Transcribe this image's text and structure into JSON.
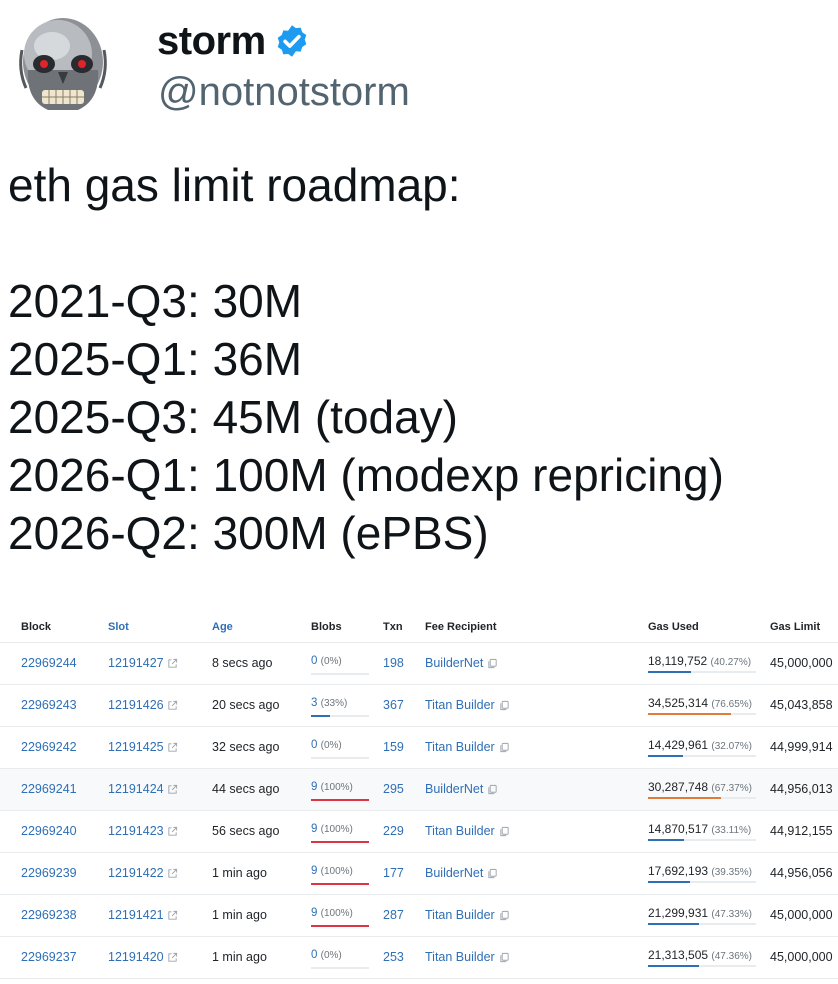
{
  "tweet": {
    "display_name": "storm",
    "handle": "@notnotstorm",
    "verified_icon": "verified-badge-icon",
    "lines": [
      "eth gas limit roadmap:",
      "",
      "2021-Q3: 30M",
      "2025-Q1: 36M",
      "2025-Q3: 45M (today)",
      "2026-Q1: 100M (modexp repricing)",
      "2026-Q2: 300M (ePBS)"
    ]
  },
  "table": {
    "headers": {
      "block": "Block",
      "slot": "Slot",
      "age": "Age",
      "blobs": "Blobs",
      "txn": "Txn",
      "fee_recipient": "Fee Recipient",
      "gas_used": "Gas Used",
      "gas_limit": "Gas Limit"
    },
    "colors": {
      "link": "#2f6fb6",
      "blob_low": "#2f6fb6",
      "blob_full": "#dc3545",
      "gas_normal": "#2f6fb6",
      "gas_high": "#e07b39"
    },
    "rows": [
      {
        "block": "22969244",
        "slot": "12191427",
        "age": "8 secs ago",
        "blobs": "0",
        "blobs_pct": "(0%)",
        "blobs_level": 0,
        "txn": "198",
        "fee_recipient": "BuilderNet",
        "gas_used": "18,119,752",
        "gas_pct": "(40.27%)",
        "gas_level": 0.4027,
        "gas_limit": "45,000,000",
        "shaded": false
      },
      {
        "block": "22969243",
        "slot": "12191426",
        "age": "20 secs ago",
        "blobs": "3",
        "blobs_pct": "(33%)",
        "blobs_level": 0.33,
        "txn": "367",
        "fee_recipient": "Titan Builder",
        "gas_used": "34,525,314",
        "gas_pct": "(76.65%)",
        "gas_level": 0.7665,
        "gas_limit": "45,043,858",
        "shaded": false
      },
      {
        "block": "22969242",
        "slot": "12191425",
        "age": "32 secs ago",
        "blobs": "0",
        "blobs_pct": "(0%)",
        "blobs_level": 0,
        "txn": "159",
        "fee_recipient": "Titan Builder",
        "gas_used": "14,429,961",
        "gas_pct": "(32.07%)",
        "gas_level": 0.3207,
        "gas_limit": "44,999,914",
        "shaded": false
      },
      {
        "block": "22969241",
        "slot": "12191424",
        "age": "44 secs ago",
        "blobs": "9",
        "blobs_pct": "(100%)",
        "blobs_level": 1,
        "txn": "295",
        "fee_recipient": "BuilderNet",
        "gas_used": "30,287,748",
        "gas_pct": "(67.37%)",
        "gas_level": 0.6737,
        "gas_limit": "44,956,013",
        "shaded": true
      },
      {
        "block": "22969240",
        "slot": "12191423",
        "age": "56 secs ago",
        "blobs": "9",
        "blobs_pct": "(100%)",
        "blobs_level": 1,
        "txn": "229",
        "fee_recipient": "Titan Builder",
        "gas_used": "14,870,517",
        "gas_pct": "(33.11%)",
        "gas_level": 0.3311,
        "gas_limit": "44,912,155",
        "shaded": false
      },
      {
        "block": "22969239",
        "slot": "12191422",
        "age": "1 min ago",
        "blobs": "9",
        "blobs_pct": "(100%)",
        "blobs_level": 1,
        "txn": "177",
        "fee_recipient": "BuilderNet",
        "gas_used": "17,692,193",
        "gas_pct": "(39.35%)",
        "gas_level": 0.3935,
        "gas_limit": "44,956,056",
        "shaded": false
      },
      {
        "block": "22969238",
        "slot": "12191421",
        "age": "1 min ago",
        "blobs": "9",
        "blobs_pct": "(100%)",
        "blobs_level": 1,
        "txn": "287",
        "fee_recipient": "Titan Builder",
        "gas_used": "21,299,931",
        "gas_pct": "(47.33%)",
        "gas_level": 0.4733,
        "gas_limit": "45,000,000",
        "shaded": false
      },
      {
        "block": "22969237",
        "slot": "12191420",
        "age": "1 min ago",
        "blobs": "0",
        "blobs_pct": "(0%)",
        "blobs_level": 0,
        "txn": "253",
        "fee_recipient": "Titan Builder",
        "gas_used": "21,313,505",
        "gas_pct": "(47.36%)",
        "gas_level": 0.4736,
        "gas_limit": "45,000,000",
        "shaded": false
      }
    ]
  }
}
